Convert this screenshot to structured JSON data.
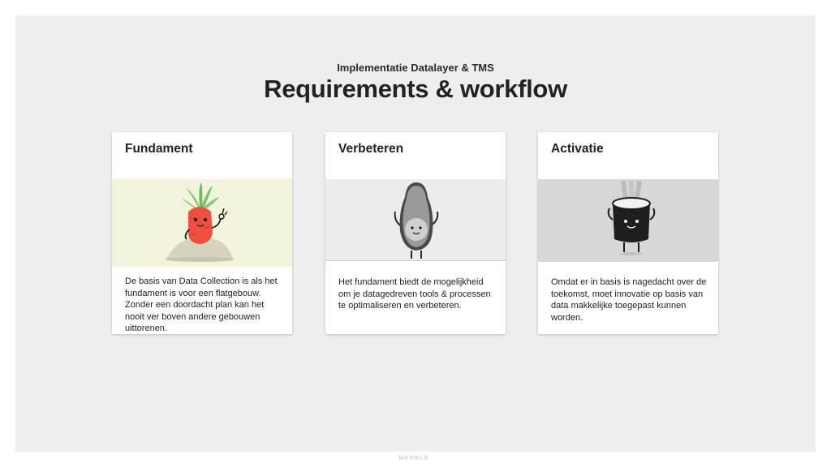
{
  "header": {
    "subtitle": "Implementatie Datalayer & TMS",
    "title": "Requirements & workflow"
  },
  "cards": [
    {
      "title": "Fundament",
      "illustration": "carrot-character-icon",
      "description": "De basis van Data Collection is als het fundament is voor een flatgebouw. Zonder een doordacht plan kan het nooit ver boven andere gebouwen uittorenen.",
      "bg_color": "#f3f2dc"
    },
    {
      "title": "Verbeteren",
      "illustration": "avocado-character-icon",
      "description": "Het fundament biedt de mogelijkheid om je datagedreven tools & processen te optimaliseren en verbeteren.",
      "bg_color": "#ececec"
    },
    {
      "title": "Activatie",
      "illustration": "sushi-roll-character-icon",
      "description": "Omdat er in basis is nagedacht over de toekomst, moet innovatie op basis van data makkelijke toegepast kunnen worden.",
      "bg_color": "#d7d7d7"
    }
  ],
  "footer": {
    "logo_text": "MERKLE."
  }
}
